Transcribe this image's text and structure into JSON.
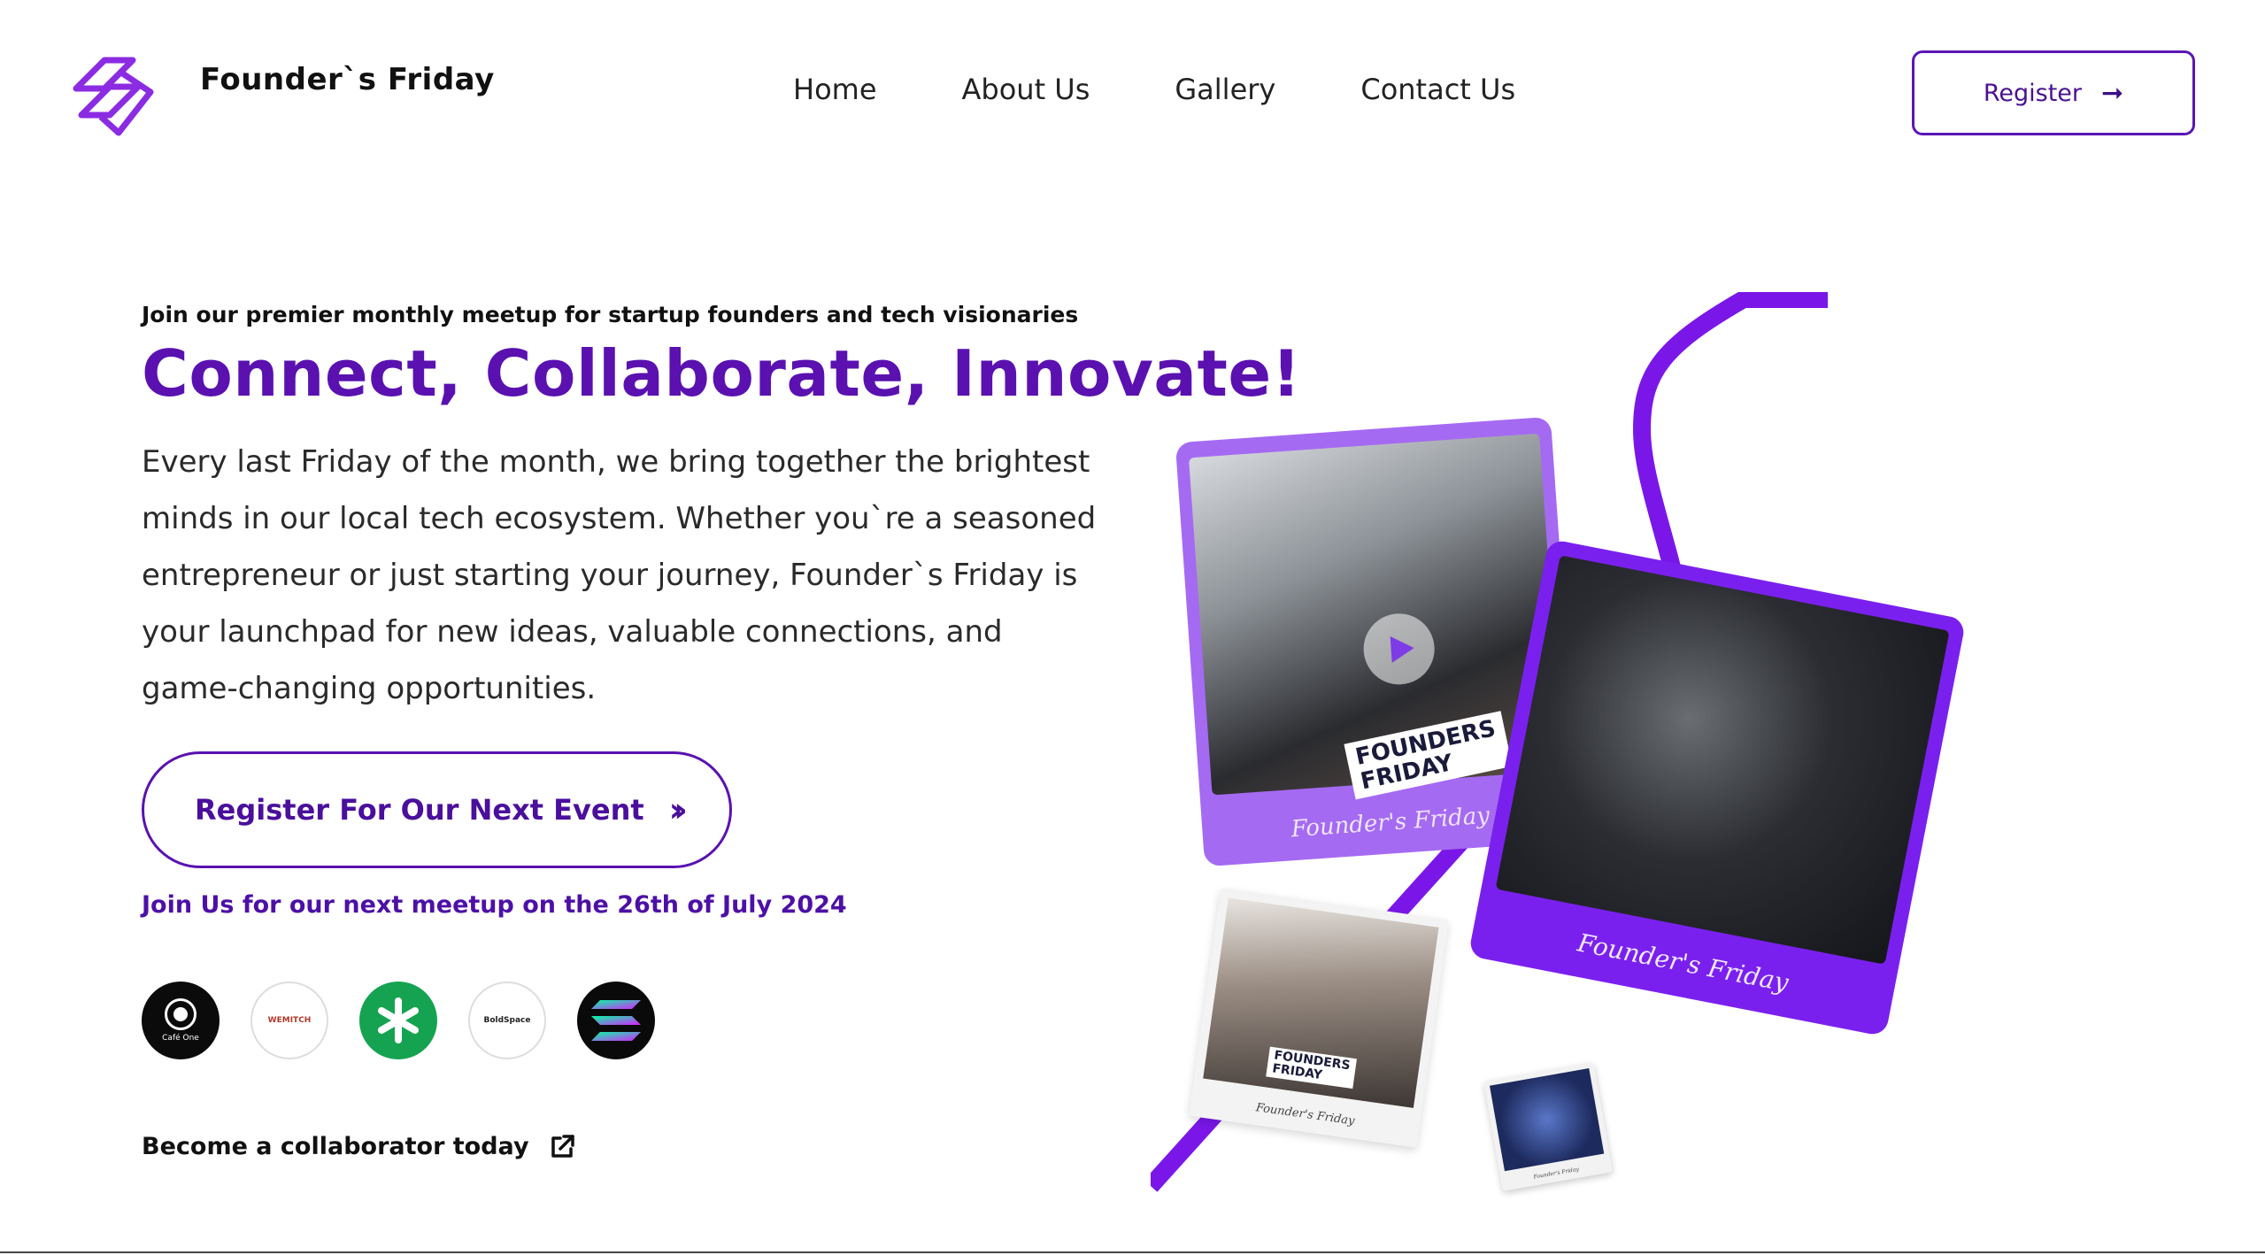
{
  "brand": {
    "name": "Founder`s Friday"
  },
  "nav": {
    "items": [
      {
        "label": "Home"
      },
      {
        "label": "About Us"
      },
      {
        "label": "Gallery"
      },
      {
        "label": "Contact Us"
      }
    ]
  },
  "header": {
    "register_label": "Register",
    "register_icon": "arrow-right-icon"
  },
  "hero": {
    "eyebrow": "Join our premier monthly meetup for startup founders and tech visionaries",
    "headline": "Connect, Collaborate, Innovate!",
    "body": "Every last Friday of the month, we bring together the brightest minds in our local tech ecosystem. Whether you`re a seasoned entrepreneur or just starting your journey, Founder`s Friday is your launchpad for new ideas, valuable connections, and game-changing opportunities.",
    "cta_label": "Register For Our Next Event",
    "next_meetup": "Join Us for our next meetup on the 26th of July 2024",
    "collab_label": "Become a collaborator today"
  },
  "partners": [
    {
      "name": "Café One"
    },
    {
      "name": "WEMITCH"
    },
    {
      "name": "green-asterisk-logo"
    },
    {
      "name": "BoldSpace"
    },
    {
      "name": "solana-logo"
    }
  ],
  "gallery": {
    "caption": "Founder's Friday",
    "tag_line1": "FOUNDERS",
    "tag_line2": "FRIDAY"
  },
  "colors": {
    "accent": "#5a11b0",
    "accent_light": "#a56af2",
    "line": "#7a17e8"
  }
}
